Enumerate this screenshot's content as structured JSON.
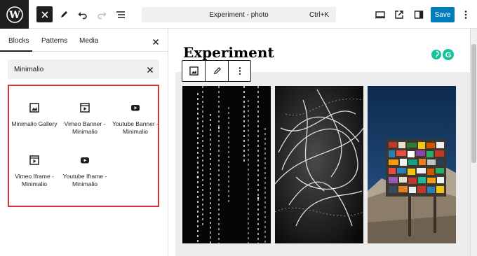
{
  "header": {
    "document_title": "Experiment - photo",
    "shortcut": "Ctrl+K",
    "save_label": "Save"
  },
  "sidebar": {
    "tabs": [
      {
        "label": "Blocks",
        "active": true
      },
      {
        "label": "Patterns",
        "active": false
      },
      {
        "label": "Media",
        "active": false
      }
    ],
    "search": {
      "value": "Minimalio"
    },
    "results": [
      {
        "label": "Minimalio Gallery",
        "icon": "gallery-icon"
      },
      {
        "label": "Vimeo Banner - Minimalio",
        "icon": "video-icon"
      },
      {
        "label": "Youtube Banner - Minimalio",
        "icon": "youtube-icon"
      },
      {
        "label": "Vimeo Iframe - Minimalio",
        "icon": "video-icon"
      },
      {
        "label": "Youtube Iframe - Minimalio",
        "icon": "youtube-icon"
      }
    ],
    "highlight_color": "#d63638"
  },
  "canvas": {
    "heading": "Experiment"
  },
  "colors": {
    "accent": "#007cba",
    "dark": "#1e1e1e"
  }
}
